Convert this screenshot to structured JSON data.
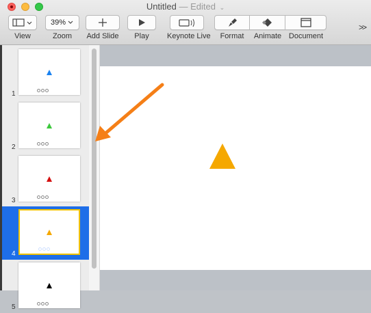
{
  "window": {
    "title": "Untitled",
    "status": "— Edited",
    "title_chevron": "⌄"
  },
  "toolbar": {
    "view_label": "View",
    "zoom_value": "39%",
    "zoom_label": "Zoom",
    "add_slide_label": "Add Slide",
    "play_label": "Play",
    "keynote_live_label": "Keynote Live",
    "format_label": "Format",
    "animate_label": "Animate",
    "document_label": "Document",
    "overflow": ">>"
  },
  "navigator": {
    "slides": [
      {
        "number": "1",
        "shape_color": "#1a82f0",
        "selected": false
      },
      {
        "number": "2",
        "shape_color": "#3cc83c",
        "selected": false
      },
      {
        "number": "3",
        "shape_color": "#d40f0f",
        "selected": false
      },
      {
        "number": "4",
        "shape_color": "#f5a800",
        "selected": true
      },
      {
        "number": "5",
        "shape_color": "#000000",
        "selected": false
      }
    ]
  },
  "canvas": {
    "shape": "triangle",
    "shape_color": "#f5a800"
  },
  "annotation": {
    "arrow_color": "#f57f17"
  },
  "colors": {
    "selection": "#1e6ee8",
    "selected_border": "#f2c200"
  }
}
